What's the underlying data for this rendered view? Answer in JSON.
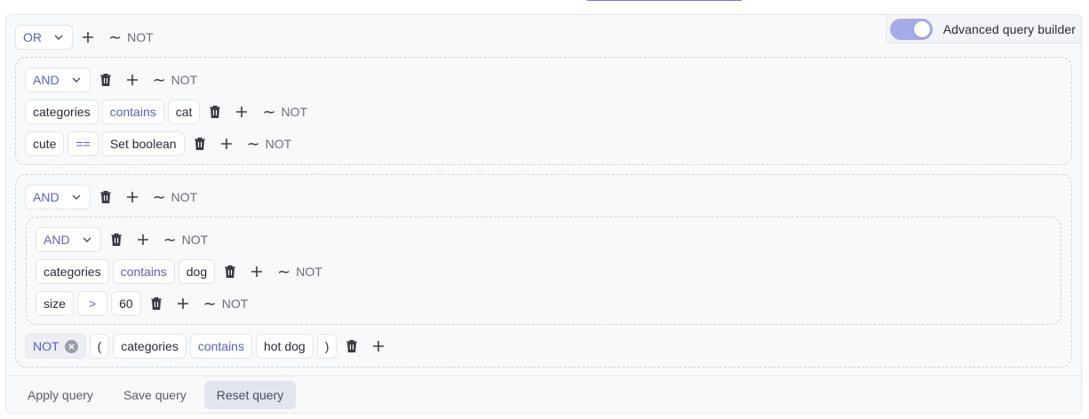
{
  "toggle": {
    "label": "Advanced query builder",
    "on": true
  },
  "root": {
    "combinator": "OR",
    "not_label": "NOT"
  },
  "group1": {
    "combinator": "AND",
    "not_label": "NOT",
    "rules": [
      {
        "field": "categories",
        "operator": "contains",
        "value": "cat",
        "not_label": "NOT"
      },
      {
        "field": "cute",
        "operator": "==",
        "value": "Set boolean",
        "not_label": "NOT"
      }
    ]
  },
  "group2": {
    "combinator": "AND",
    "not_label": "NOT",
    "inner": {
      "combinator": "AND",
      "not_label": "NOT",
      "rules": [
        {
          "field": "categories",
          "operator": "contains",
          "value": "dog",
          "not_label": "NOT"
        },
        {
          "field": "size",
          "operator": ">",
          "value": "60",
          "not_label": "NOT"
        }
      ]
    },
    "negated_rule": {
      "not_badge": "NOT",
      "open_paren": "(",
      "field": "categories",
      "operator": "contains",
      "value": "hot dog",
      "close_paren": ")"
    }
  },
  "footer": {
    "apply": "Apply query",
    "save": "Save query",
    "reset": "Reset query"
  },
  "colors": {
    "accent": "#5a5fc4",
    "toggle_track": "#a7aae8"
  }
}
